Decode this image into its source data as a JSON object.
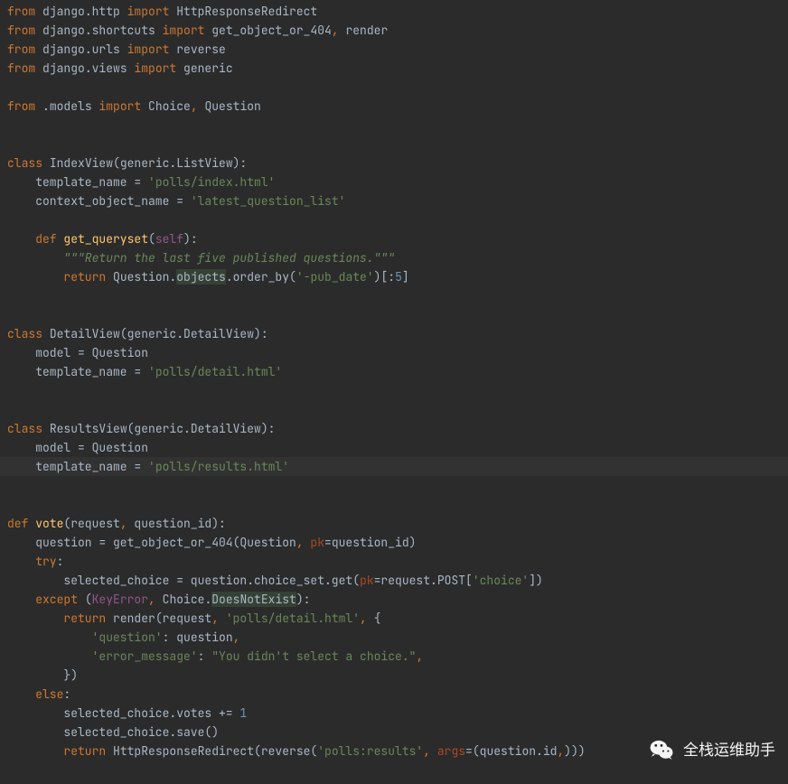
{
  "watermark": {
    "text": "全栈运维助手"
  },
  "code": {
    "l1": {
      "a": "from ",
      "b": "django.http ",
      "c": "import ",
      "d": "HttpResponseRedirect"
    },
    "l2": {
      "a": "from ",
      "b": "django.shortcuts ",
      "c": "import ",
      "d": "get_object_or_404",
      "e": ", ",
      "f": "render"
    },
    "l3": {
      "a": "from ",
      "b": "django.urls ",
      "c": "import ",
      "d": "reverse"
    },
    "l4": {
      "a": "from ",
      "b": "django.views ",
      "c": "import ",
      "d": "generic"
    },
    "l6": {
      "a": "from ",
      "b": ".models ",
      "c": "import ",
      "d": "Choice",
      "e": ", ",
      "f": "Question"
    },
    "l9": {
      "a": "class ",
      "b": "IndexView",
      "c": "(generic.ListView):"
    },
    "l10": {
      "a": "    template_name = ",
      "b": "'polls/index.html'"
    },
    "l11": {
      "a": "    context_object_name = ",
      "b": "'latest_question_list'"
    },
    "l13": {
      "a": "    ",
      "b": "def ",
      "c": "get_queryset",
      "d": "(",
      "e": "self",
      "f": "):"
    },
    "l14": {
      "a": "        ",
      "b": "\"\"\"Return the last five published questions.\"\"\""
    },
    "l15": {
      "a": "        ",
      "b": "return ",
      "c": "Question.",
      "d": "objects",
      "e": ".order_by(",
      "f": "'-pub_date'",
      "g": ")[:",
      "h": "5",
      "i": "]"
    },
    "l18": {
      "a": "class ",
      "b": "DetailView",
      "c": "(generic.DetailView):"
    },
    "l19": {
      "a": "    model = Question"
    },
    "l20": {
      "a": "    template_name = ",
      "b": "'polls/detail.html'"
    },
    "l23": {
      "a": "class ",
      "b": "ResultsView",
      "c": "(generic.DetailView):"
    },
    "l24": {
      "a": "    model = Question"
    },
    "l25": {
      "a": "    template_name = ",
      "b": "'polls/results.html'"
    },
    "l28": {
      "a": "def ",
      "b": "vote",
      "c": "(request",
      "d": ", ",
      "e": "question_id):"
    },
    "l29": {
      "a": "    question = get_object_or_404(Question",
      "b": ", ",
      "c": "pk",
      "d": "=question_id)"
    },
    "l30": {
      "a": "    ",
      "b": "try",
      "c": ":"
    },
    "l31": {
      "a": "        selected_choice = question.choice_set.get(",
      "b": "pk",
      "c": "=request.POST[",
      "d": "'choice'",
      "e": "])"
    },
    "l32": {
      "a": "    ",
      "b": "except ",
      "c": "(",
      "d": "KeyError",
      "e": ", ",
      "f": "Choice.",
      "g": "DoesNotExist",
      "h": "):"
    },
    "l33": {
      "a": "        ",
      "b": "return ",
      "c": "render(request",
      "d": ", ",
      "e": "'polls/detail.html'",
      "f": ", ",
      "g": "{"
    },
    "l34": {
      "a": "            ",
      "b": "'question'",
      "c": ": question",
      "d": ","
    },
    "l35": {
      "a": "            ",
      "b": "'error_message'",
      "c": ": ",
      "d": "\"You didn't select a choice.\"",
      "e": ","
    },
    "l36": {
      "a": "        })"
    },
    "l37": {
      "a": "    ",
      "b": "else",
      "c": ":"
    },
    "l38": {
      "a": "        selected_choice.votes += ",
      "b": "1"
    },
    "l39": {
      "a": "        selected_choice.save()"
    },
    "l40": {
      "a": "        ",
      "b": "return ",
      "c": "HttpResponseRedirect(reverse(",
      "d": "'polls:results'",
      "e": ", ",
      "f": "args",
      "g": "=(question.id",
      "h": ",",
      "i": ")))"
    }
  }
}
